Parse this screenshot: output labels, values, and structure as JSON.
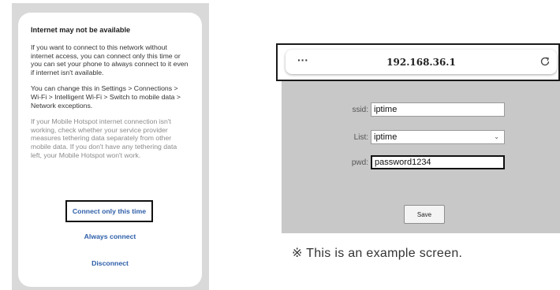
{
  "phone_dialog": {
    "title": "Internet may not be available",
    "paragraph_1": "If you want to connect to this network without internet access, you can connect only this time or you can set your phone to always connect to it even if internet isn't available.",
    "paragraph_2": "You can change this in Settings > Connections > Wi-Fi > Intelligent Wi-Fi > Switch to mobile data > Network exceptions.",
    "paragraph_3": "If your Mobile Hotspot internet connection isn't working, check whether your service provider measures tethering data separately from other mobile data. If you don't have any tethering data left, your Mobile Hotspot won't work.",
    "actions": {
      "connect_once": "Connect only this time",
      "always_connect": "Always connect",
      "disconnect": "Disconnect"
    }
  },
  "browser": {
    "menu_icon": "more-horizontal-icon",
    "url": "192.168.36.1",
    "reload_icon": "reload-icon"
  },
  "router_form": {
    "ssid_label": "ssid:",
    "ssid_value": "iptime",
    "list_label": "List:",
    "list_selected": "iptime",
    "pwd_label": "pwd:",
    "pwd_value": "password1234",
    "save_label": "Save"
  },
  "caption": "※ This is an example screen."
}
